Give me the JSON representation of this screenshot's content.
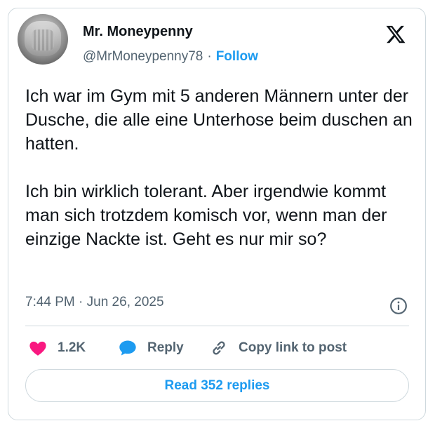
{
  "author": {
    "name": "Mr. Moneypenny",
    "handle": "@MrMoneypenny78",
    "separator": "·",
    "follow_label": "Follow"
  },
  "tweet": {
    "text": "Ich war im Gym mit 5 anderen Männern unter der Dusche, die alle eine Unterhose beim duschen an hatten.\n\nIch bin wirklich tolerant. Aber irgendwie kommt man sich trotzdem komisch vor, wenn man der einzige Nackte ist. Geht es nur mir so?",
    "timestamp": "7:44 PM · Jun 26, 2025"
  },
  "actions": {
    "like_count": "1.2K",
    "reply_label": "Reply",
    "copy_label": "Copy link to post"
  },
  "read_replies_label": "Read 352 replies",
  "icons": {
    "brand": "x-logo-icon",
    "info": "info-icon",
    "like": "heart-icon",
    "reply": "speech-bubble-icon",
    "copy": "link-icon"
  },
  "colors": {
    "accent": "#1d9bf0",
    "like": "#f91880",
    "text": "#0f1419",
    "muted": "#536471",
    "border": "#cfd9de"
  }
}
